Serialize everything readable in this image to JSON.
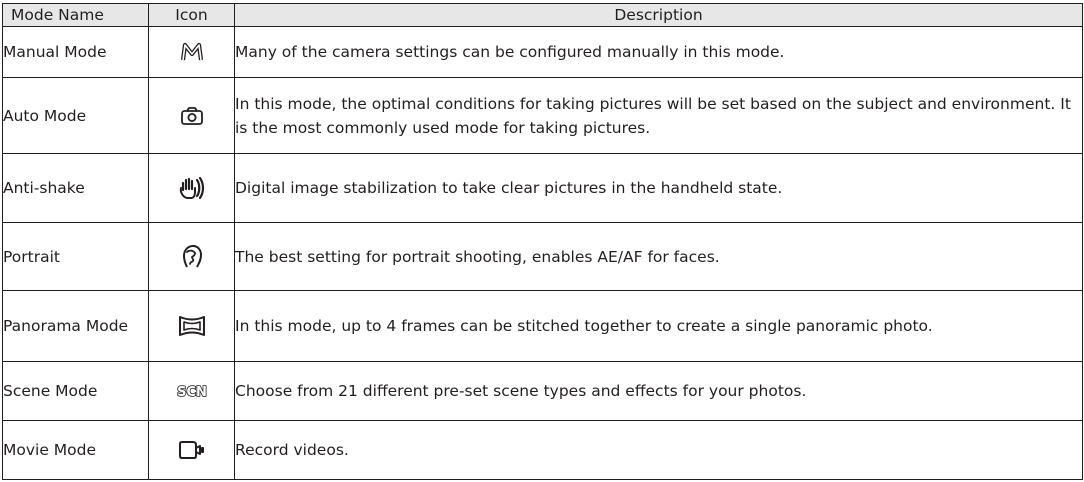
{
  "table": {
    "headers": {
      "mode_name": "Mode Name",
      "icon": "Icon",
      "description": "Description"
    },
    "rows": [
      {
        "name": "Manual Mode",
        "icon": "manual-mode-icon",
        "description": "Many of the camera settings can be configured manually in this mode."
      },
      {
        "name": "Auto Mode",
        "icon": "camera-icon",
        "description": "In this mode, the optimal conditions for taking pictures will be set based on the subject and environment. It is the most commonly used mode for taking pictures."
      },
      {
        "name": "Anti-shake",
        "icon": "hand-shake-icon",
        "description": "Digital image stabilization to take clear pictures in the handheld state."
      },
      {
        "name": "Portrait",
        "icon": "portrait-face-icon",
        "description": "The best setting for portrait shooting, enables AE/AF for faces."
      },
      {
        "name": "Panorama Mode",
        "icon": "panorama-icon",
        "description": "In this mode, up to 4 frames can be stitched together to create a single panoramic photo."
      },
      {
        "name": "Scene Mode",
        "icon": "scn-icon",
        "description": "Choose from 21 different pre-set scene types and effects for your photos."
      },
      {
        "name": "Movie Mode",
        "icon": "movie-camera-icon",
        "description": "Record videos."
      }
    ]
  },
  "icon_labels": {
    "scene": "SCN"
  },
  "colors": {
    "text": "#231f20",
    "header_bg": "#e7e7e8",
    "border": "#231f20"
  }
}
